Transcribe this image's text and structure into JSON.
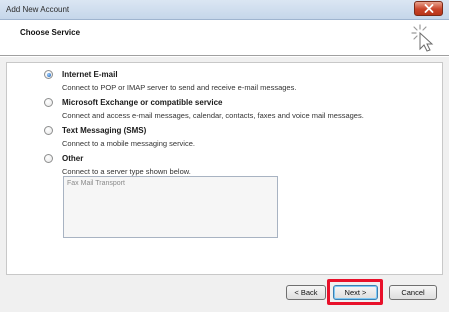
{
  "window": {
    "title": "Add New Account",
    "close_icon": "close-icon"
  },
  "header": {
    "title": "Choose Service",
    "icon": "wizard-cursor-icon"
  },
  "options": [
    {
      "label": "Internet E-mail",
      "description": "Connect to POP or IMAP server to send and receive e-mail messages.",
      "selected": true
    },
    {
      "label": "Microsoft Exchange or compatible service",
      "description": "Connect and access e-mail messages, calendar, contacts, faxes and voice mail messages.",
      "selected": false
    },
    {
      "label": "Text Messaging (SMS)",
      "description": "Connect to a mobile messaging service.",
      "selected": false
    },
    {
      "label": "Other",
      "description": "Connect to a server type shown below.",
      "selected": false
    }
  ],
  "other_server_types": [
    "Fax Mail Transport"
  ],
  "buttons": {
    "back": "< Back",
    "next": "Next >",
    "cancel": "Cancel"
  },
  "colors": {
    "highlight": "#e8102a",
    "titlebar": "#c5d6ea",
    "close_button": "#c9442a"
  }
}
